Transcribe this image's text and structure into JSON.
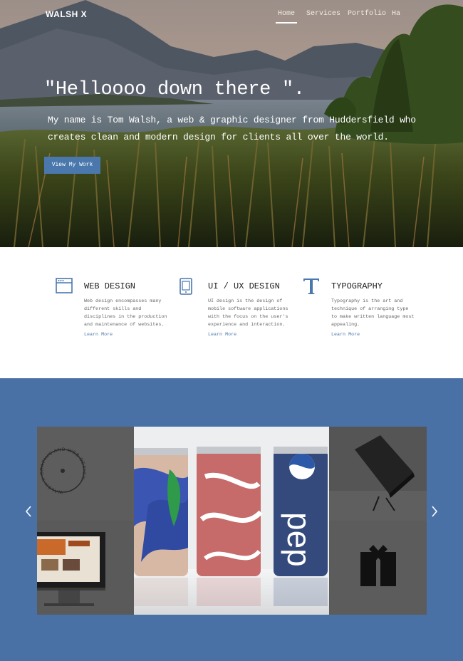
{
  "nav": {
    "logo": "WALSH X",
    "links": [
      {
        "label": "Home",
        "active": true
      },
      {
        "label": "Services",
        "active": false
      },
      {
        "label": "Portfolio",
        "active": false
      },
      {
        "label": "Ha",
        "active": false
      }
    ]
  },
  "hero": {
    "heading": "\"Helloooo down there \".",
    "text": "My name is Tom Walsh, a web & graphic designer from Huddersfield who creates clean and modern design for clients all over the world.",
    "button_label": "View My Work"
  },
  "services": [
    {
      "icon": "browser-window-icon",
      "title": "WEB DESIGN",
      "description": "Web design encompasses many different skills and disciplines in the production and maintenance of websites.",
      "link": "Learn More"
    },
    {
      "icon": "mobile-device-icon",
      "title": "UI / UX DESIGN",
      "description": "UI design is the design of mobile software applications with the focus on the user's experience and interaction.",
      "link": "Learn More"
    },
    {
      "icon": "typography-t-icon",
      "title": "TYPOGRAPHY",
      "description": "Typography is the art and technique of arranging type to make written language most appealing.",
      "link": "Learn More"
    }
  ],
  "portfolio": {
    "badge_text": "WALSH X GRAPHIC AND WEB DESIGN",
    "can_text": "pep",
    "colors": {
      "section_bg": "#4a71a6",
      "accent": "#4a77ac",
      "tile_gray": "#555555"
    }
  }
}
